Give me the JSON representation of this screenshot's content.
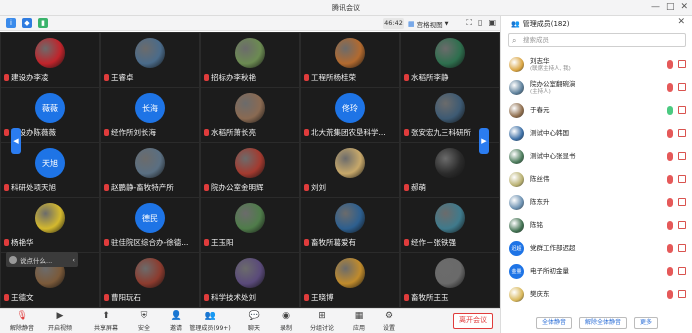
{
  "window": {
    "title": "腾讯会议"
  },
  "topbar": {
    "time": "46:42",
    "view_label": "宫格视图"
  },
  "grid": {
    "tiles": [
      {
        "name": "建设办李凌",
        "color": "#c0242b",
        "text": "",
        "photo": true
      },
      {
        "name": "王睿卓",
        "color": "#4a6b8a",
        "text": "",
        "photo": true
      },
      {
        "name": "招标办李秋艳",
        "color": "#6c8b52",
        "text": "",
        "photo": true
      },
      {
        "name": "工程所杨桂荣",
        "color": "#b26a2f",
        "text": "",
        "photo": true
      },
      {
        "name": "水稻所李静",
        "color": "#2e6f4e",
        "text": "",
        "photo": true
      },
      {
        "name": "建设办陈薇薇",
        "color": "#1e74e6",
        "text": "薇薇",
        "photo": false
      },
      {
        "name": "经作所刘长海",
        "color": "#1e74e6",
        "text": "长海",
        "photo": false
      },
      {
        "name": "水稻所萧长亮",
        "color": "#8a6a52",
        "text": "",
        "photo": true
      },
      {
        "name": "北大荒集团农垦科学...",
        "color": "#1e74e6",
        "text": "佟玲",
        "photo": false
      },
      {
        "name": "张安宏九三科研所",
        "color": "#3d5a73",
        "text": "",
        "photo": true
      },
      {
        "name": "科研处项天旭",
        "color": "#1e74e6",
        "text": "天旭",
        "photo": false
      },
      {
        "name": "赵鹏静-畜牧特产所",
        "color": "#5a6f82",
        "text": "",
        "photo": true
      },
      {
        "name": "院办公室金明辉",
        "color": "#a33a2f",
        "text": "",
        "photo": true
      },
      {
        "name": "刘刘",
        "color": "#c7a86a",
        "text": "",
        "photo": true
      },
      {
        "name": "郝萌",
        "color": "#2b2b2b",
        "text": "",
        "photo": true
      },
      {
        "name": "杨艳华",
        "color": "#d4b92e",
        "text": "",
        "photo": true
      },
      {
        "name": "驻佳院区综合办-徐德...",
        "color": "#1e74e6",
        "text": "德民",
        "photo": false
      },
      {
        "name": "王玉阳",
        "color": "#4f7c4a",
        "text": "",
        "photo": true
      },
      {
        "name": "畜牧所葛爱有",
        "color": "#2d5f8f",
        "text": "",
        "photo": true
      },
      {
        "name": "经作－张铁强",
        "color": "#3f7a8c",
        "text": "",
        "photo": true
      },
      {
        "name": "王德文",
        "color": "#7b5a3a",
        "text": "",
        "photo": true
      },
      {
        "name": "曹阳玩石",
        "color": "#8c3b2e",
        "text": "",
        "photo": true
      },
      {
        "name": "科学技术处刘",
        "color": "#5a4a7a",
        "text": "",
        "photo": true
      },
      {
        "name": "王晓博",
        "color": "#c08b2c",
        "text": "",
        "photo": true
      },
      {
        "name": "畜牧所王玉",
        "color": "#6a6a6a",
        "text": "",
        "photo": true
      }
    ],
    "chat_popup": "说点什么..."
  },
  "toolbar": [
    {
      "label": "解除静音",
      "icon": "mic-off-icon"
    },
    {
      "label": "开启视频",
      "icon": "camera-icon"
    },
    {
      "label": "共享屏幕",
      "icon": "share-screen-icon"
    },
    {
      "label": "安全",
      "icon": "shield-icon"
    },
    {
      "label": "邀请",
      "icon": "invite-icon"
    },
    {
      "label": "管理成员(99+)",
      "icon": "members-icon"
    },
    {
      "label": "聊天",
      "icon": "chat-icon"
    },
    {
      "label": "录制",
      "icon": "record-icon"
    },
    {
      "label": "分组讨论",
      "icon": "breakout-icon"
    },
    {
      "label": "应用",
      "icon": "apps-icon"
    },
    {
      "label": "设置",
      "icon": "settings-icon"
    }
  ],
  "end_button": "离开会议",
  "panel": {
    "title": "管理成员(182)",
    "search_placeholder": "搜索成员",
    "members": [
      {
        "name": "刘志华",
        "role": "(联席主持人, 我)",
        "color": "#d9a441",
        "text": "",
        "mic_on": false
      },
      {
        "name": "院办公室翻碗演",
        "role": "(主持人)",
        "color": "#5c7f9a",
        "text": "",
        "mic_on": false
      },
      {
        "name": "于春元",
        "role": "",
        "color": "#8e6d4c",
        "text": "",
        "mic_on": true
      },
      {
        "name": "测试中心韩国",
        "role": "",
        "color": "#3b6ea5",
        "text": "",
        "mic_on": false
      },
      {
        "name": "测试中心张显书",
        "role": "",
        "color": "#4a7a5a",
        "text": "",
        "mic_on": false
      },
      {
        "name": "陈丝伟",
        "role": "",
        "color": "#b8b070",
        "text": "",
        "mic_on": false
      },
      {
        "name": "陈东升",
        "role": "",
        "color": "#6a8fb0",
        "text": "",
        "mic_on": false
      },
      {
        "name": "陈铭",
        "role": "",
        "color": "#3f6f4f",
        "text": "",
        "mic_on": false
      },
      {
        "name": "党群工作部迟超",
        "role": "",
        "color": "#1e74e6",
        "text": "迟超",
        "mic_on": false
      },
      {
        "name": "电子所初金量",
        "role": "",
        "color": "#1e74e6",
        "text": "金量",
        "mic_on": false
      },
      {
        "name": "樊庆东",
        "role": "",
        "color": "#d8b75a",
        "text": "",
        "mic_on": false
      }
    ],
    "buttons": [
      "全体静音",
      "解除全体静音",
      "更多"
    ]
  }
}
